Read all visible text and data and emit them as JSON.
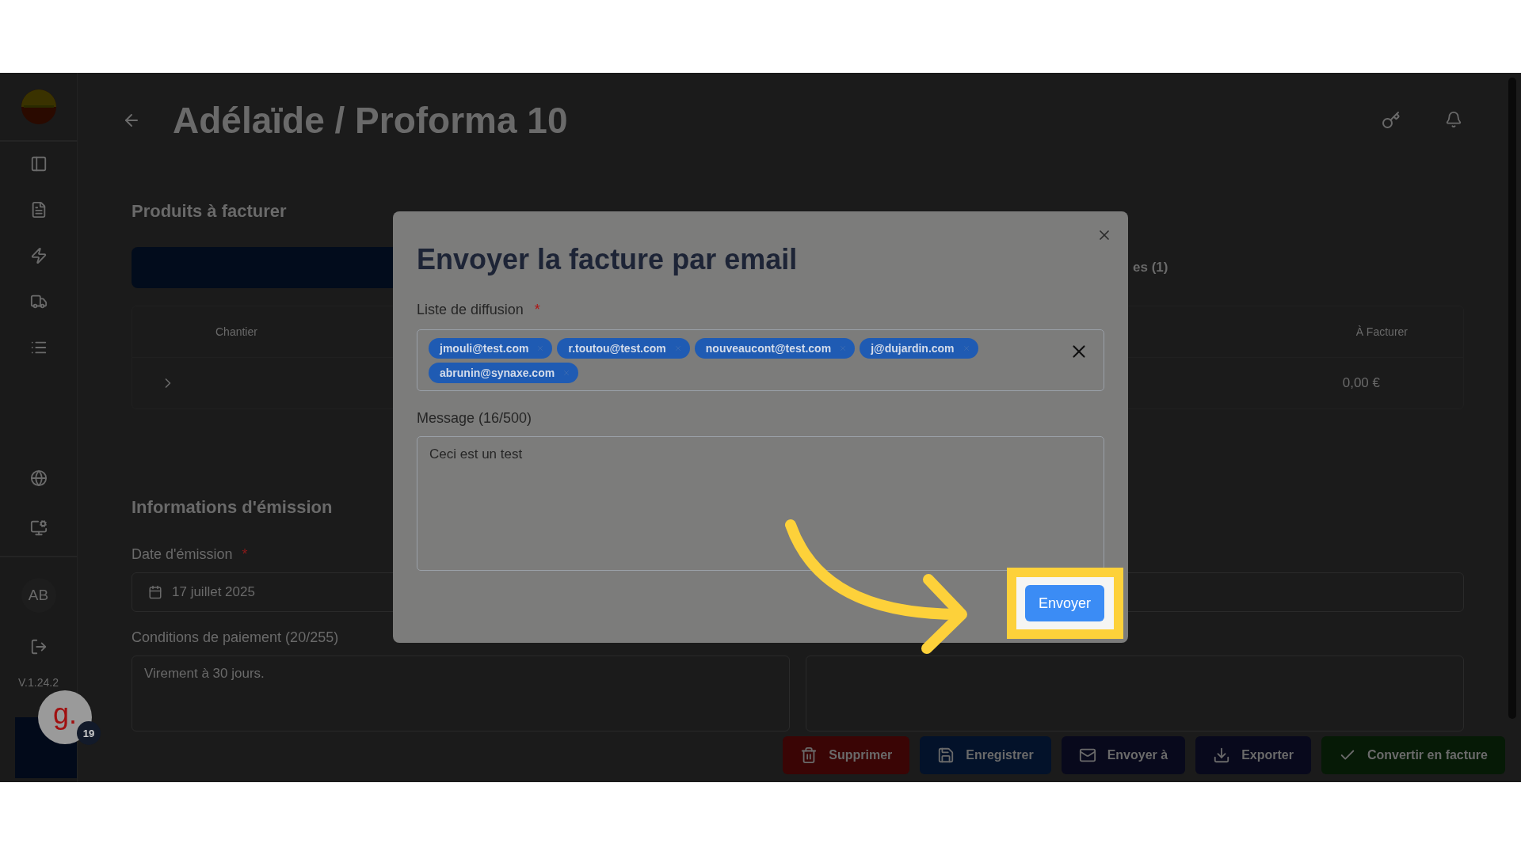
{
  "header": {
    "title": "Adélaïde / Proforma 10"
  },
  "sidebar": {
    "user_initials": "AB",
    "version": "V.1.24.2"
  },
  "products": {
    "title": "Produits à facturer",
    "tab_fragment": "es (1)",
    "columns": [
      "Chantier",
      "À Facturer"
    ],
    "rows": [
      {
        "amount": "0,00 €"
      }
    ]
  },
  "issue_info": {
    "title": "Informations d'émission",
    "date_label": "Date d'émission",
    "date_required_mark": "*",
    "date_value": "17 juillet 2025",
    "payment_label": "Conditions de paiement (20/255)",
    "payment_value": "Virement à 30 jours."
  },
  "actions": [
    {
      "label": "Supprimer",
      "kind": "delete"
    },
    {
      "label": "Enregistrer",
      "kind": "save"
    },
    {
      "label": "Envoyer à",
      "kind": "send"
    },
    {
      "label": "Exporter",
      "kind": "export"
    },
    {
      "label": "Convertir en facture",
      "kind": "convert"
    }
  ],
  "modal": {
    "title": "Envoyer la facture par email",
    "recipients_label": "Liste de diffusion",
    "recipients_required_mark": "*",
    "recipients": [
      "jmouli@test.com",
      "r.toutou@test.com",
      "nouveaucont@test.com",
      "j@dujardin.com",
      "abrunin@synaxe.com"
    ],
    "message_label": "Message (16/500)",
    "message_value": "Ceci est un test",
    "submit": "Envoyer"
  },
  "chat_widget": {
    "logo": "g.",
    "badge": "19"
  }
}
